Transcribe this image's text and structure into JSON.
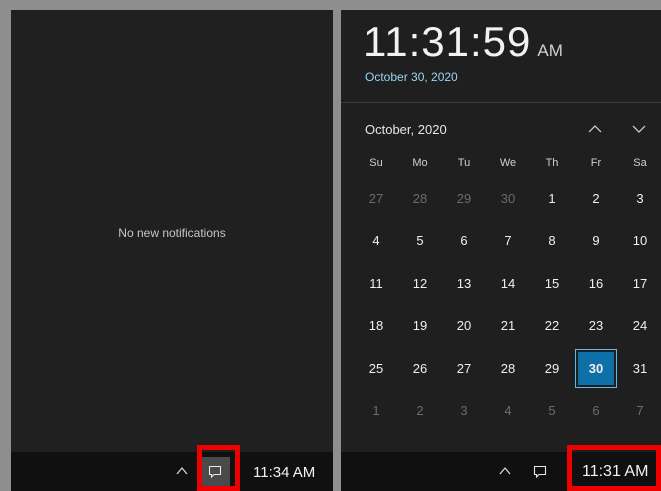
{
  "left_panel": {
    "empty_message": "No new notifications"
  },
  "left_taskbar": {
    "chevron_icon": "chevron-up-icon",
    "action_center_icon": "action-center-icon",
    "time": "11:34 AM"
  },
  "clock": {
    "time": "11:31:59",
    "ampm": "AM",
    "date": "October 30, 2020"
  },
  "calendar": {
    "month_label": "October, 2020",
    "prev_icon": "chevron-up-icon",
    "next_icon": "chevron-down-icon",
    "weekdays": [
      "Su",
      "Mo",
      "Tu",
      "We",
      "Th",
      "Fr",
      "Sa"
    ],
    "days": [
      "27",
      "28",
      "29",
      "30",
      "1",
      "2",
      "3",
      "4",
      "5",
      "6",
      "7",
      "8",
      "9",
      "10",
      "11",
      "12",
      "13",
      "14",
      "15",
      "16",
      "17",
      "18",
      "19",
      "20",
      "21",
      "22",
      "23",
      "24",
      "25",
      "26",
      "27",
      "28",
      "29",
      "30",
      "31",
      "1",
      "2",
      "3",
      "4",
      "5",
      "6",
      "7"
    ],
    "other_month_count_start": 4,
    "other_month_count_end": 7,
    "selected_day": "30"
  },
  "right_taskbar": {
    "chevron_icon": "chevron-up-icon",
    "action_center_icon": "action-center-icon",
    "time": "11:31 AM"
  },
  "colors": {
    "panel": "#1f1f1f",
    "taskbar": "#101010",
    "accent": "#0f6fa7",
    "highlight": "#ee0000"
  }
}
